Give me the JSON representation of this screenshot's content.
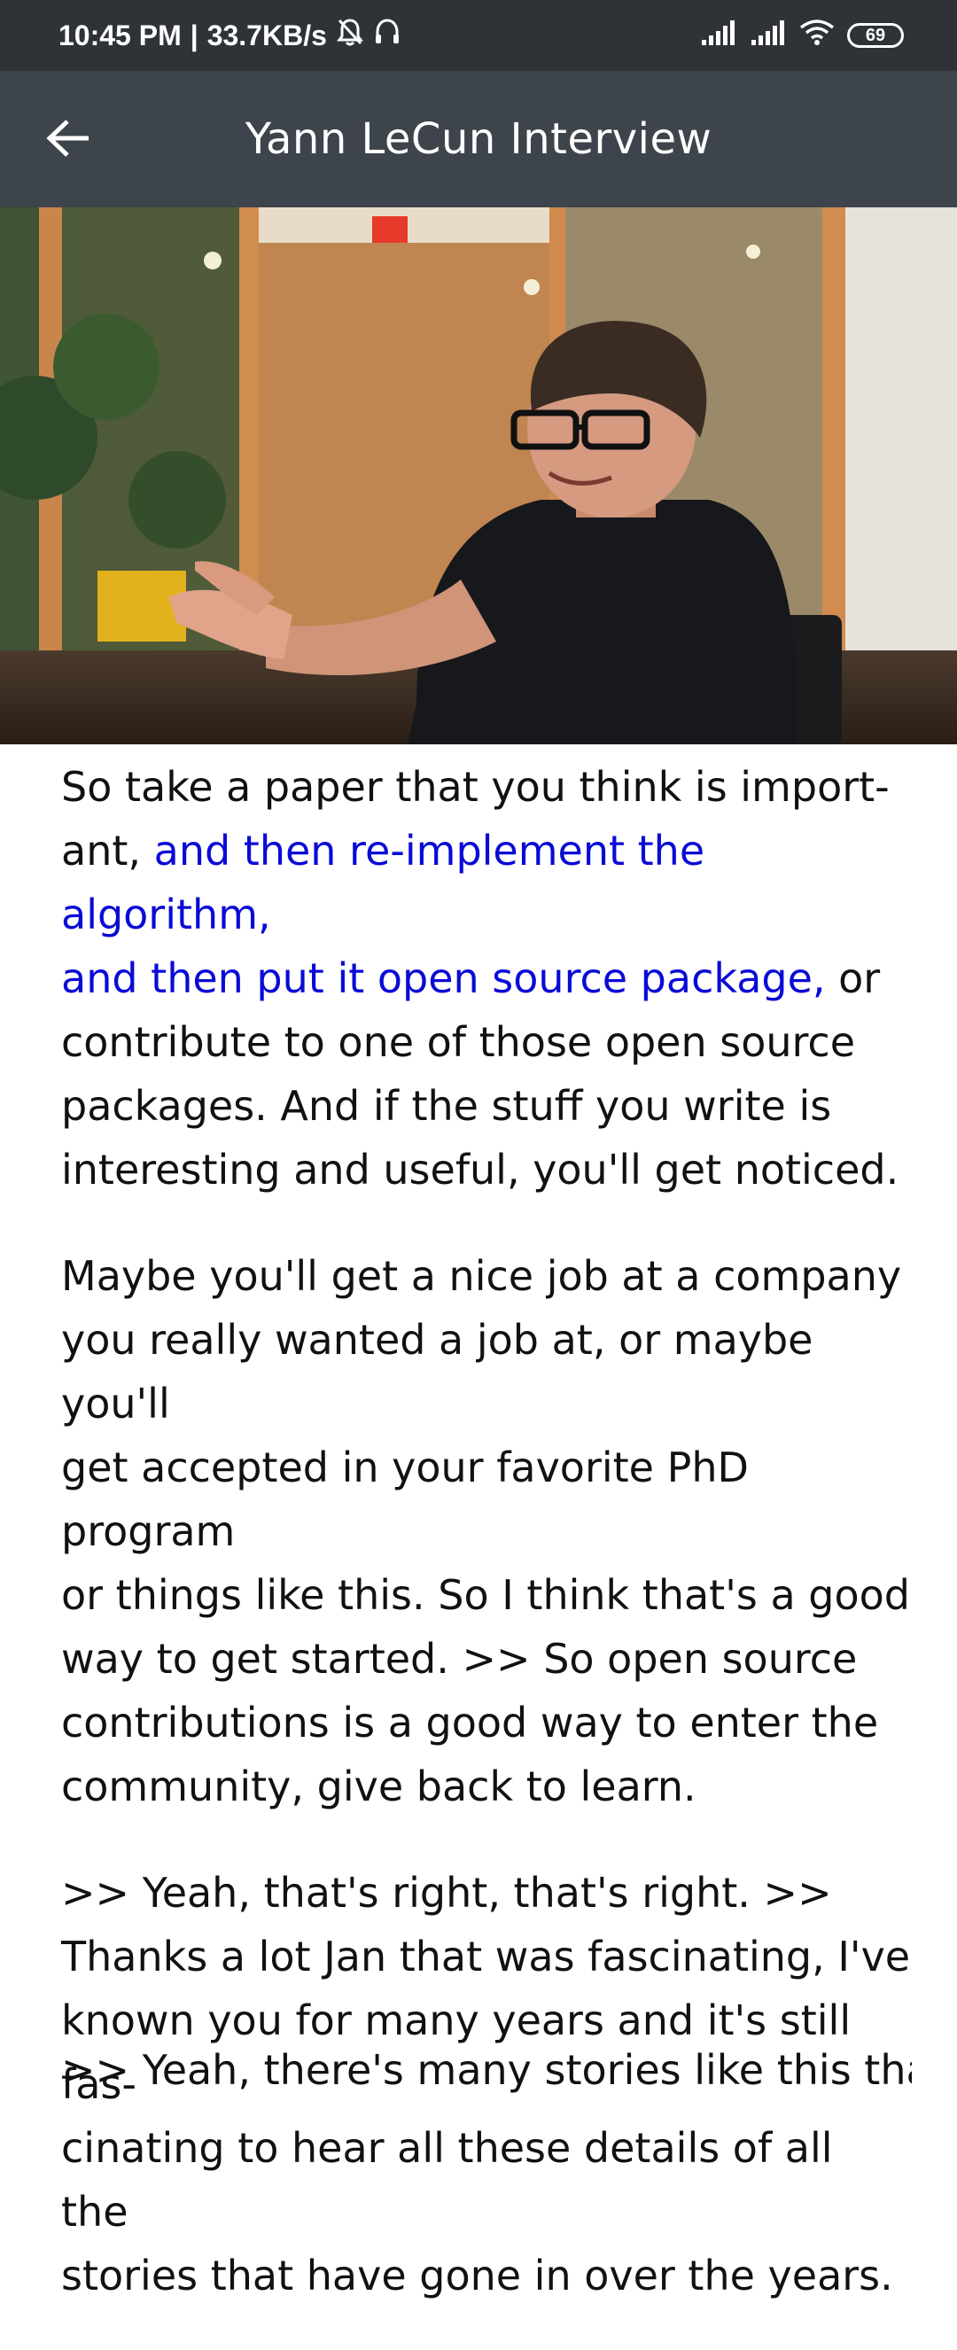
{
  "status_bar": {
    "time": "10:45 PM",
    "separator": "|",
    "speed": "33.7KB/s",
    "battery": "69"
  },
  "app_bar": {
    "title": "Yann LeCun Interview"
  },
  "transcript": {
    "p1_start": "So take a paper that you think is import-\nant, ",
    "p1_highlight": "and then re-implement the algorithm,\nand then put it open source package,",
    "p1_end": " or\ncontribute to one of those open source\npackages. And if the stuff you write is\ninteresting and useful, you'll get noticed.",
    "p2": "Maybe you'll get a nice job at a company\nyou really wanted a job at, or maybe you'll\nget accepted in your favorite PhD program\nor things like this. So I think that's a good\nway to get started.  >> So open source\ncontributions is a good way to enter the\ncommunity, give back to learn.",
    "p3": ">> Yeah, that's right, that's right.  >>\nThanks a lot Jan that was fascinating, I've\nknown you for many years and it's still fas-\ncinating to hear all these details of all the\nstories that have gone in over the years.",
    "p4_partial": ">> Yeah, there's many stories like this that"
  },
  "colors": {
    "status_bar_bg": "#2f3338",
    "app_bar_bg": "#3e444b",
    "highlight_text": "#0a0ad6",
    "body_text": "#111111"
  }
}
